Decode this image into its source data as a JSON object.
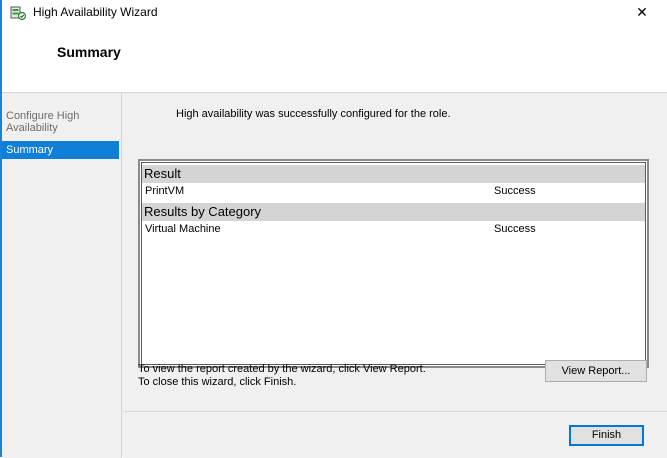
{
  "window": {
    "title": "High Availability Wizard",
    "close_glyph": "✕",
    "icon": "wizard-icon"
  },
  "header": {
    "title": "Summary"
  },
  "nav": {
    "items": [
      {
        "label": "Configure High Availability",
        "selected": false
      },
      {
        "label": "Summary",
        "selected": true
      }
    ]
  },
  "content": {
    "message": "High availability was successfully configured for the role.",
    "results": {
      "result_header": "Result",
      "result_rows": [
        {
          "name": "PrintVM",
          "status": "Success"
        }
      ],
      "category_header": "Results by Category",
      "category_rows": [
        {
          "name": "Virtual Machine",
          "status": "Success"
        }
      ]
    },
    "hint_line1": "To view the report created by the wizard, click View Report.",
    "hint_line2": "To close this wizard, click Finish.",
    "view_report_label": "View Report..."
  },
  "footer": {
    "finish_label": "Finish"
  },
  "colors": {
    "accent": "#0f7fd8",
    "section_header": "#d4d4d4",
    "body_bg": "#f0f0f0"
  }
}
